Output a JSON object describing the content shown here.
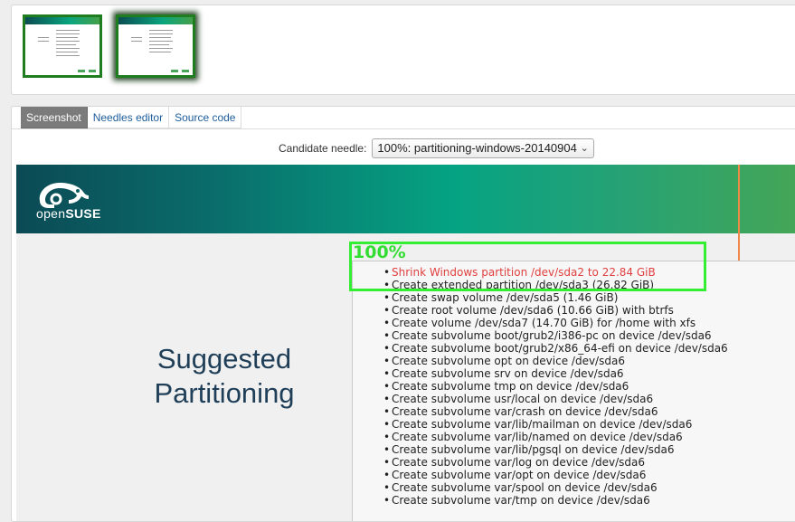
{
  "thumbnails": [
    {
      "label": "",
      "selected": false
    },
    {
      "label": "",
      "selected": true
    }
  ],
  "tabs": [
    {
      "label": "Screenshot",
      "active": true
    },
    {
      "label": "Needles editor",
      "active": false
    },
    {
      "label": "Source code",
      "active": false
    }
  ],
  "needle": {
    "label": "Candidate needle:",
    "selected": "100%: partitioning-windows-20140904"
  },
  "screen": {
    "logo_text_open": "open",
    "logo_text_suse": "SUSE",
    "heading_line1": "Suggested",
    "heading_line2": "Partitioning",
    "match_label": "100%",
    "items": [
      "Shrink Windows partition /dev/sda2 to 22.84 GiB",
      "Create extended partition /dev/sda3 (26.82 GiB)",
      "Create swap volume /dev/sda5 (1.46 GiB)",
      "Create root volume /dev/sda6 (10.66 GiB) with btrfs",
      "Create volume /dev/sda7 (14.70 GiB) for /home with xfs",
      "Create subvolume boot/grub2/i386-pc on device /dev/sda6",
      "Create subvolume boot/grub2/x86_64-efi on device /dev/sda6",
      "Create subvolume opt on device /dev/sda6",
      "Create subvolume srv on device /dev/sda6",
      "Create subvolume tmp on device /dev/sda6",
      "Create subvolume usr/local on device /dev/sda6",
      "Create subvolume var/crash on device /dev/sda6",
      "Create subvolume var/lib/mailman on device /dev/sda6",
      "Create subvolume var/lib/named on device /dev/sda6",
      "Create subvolume var/lib/pgsql on device /dev/sda6",
      "Create subvolume var/log on device /dev/sda6",
      "Create subvolume var/opt on device /dev/sda6",
      "Create subvolume var/spool on device /dev/sda6",
      "Create subvolume var/tmp on device /dev/sda6"
    ]
  },
  "colors": {
    "match_highlight": "#33ee33",
    "warning_text": "#e04040",
    "banner_start": "#0b4a55",
    "banner_end": "#46a655",
    "tab_link": "#1c5d9b"
  }
}
